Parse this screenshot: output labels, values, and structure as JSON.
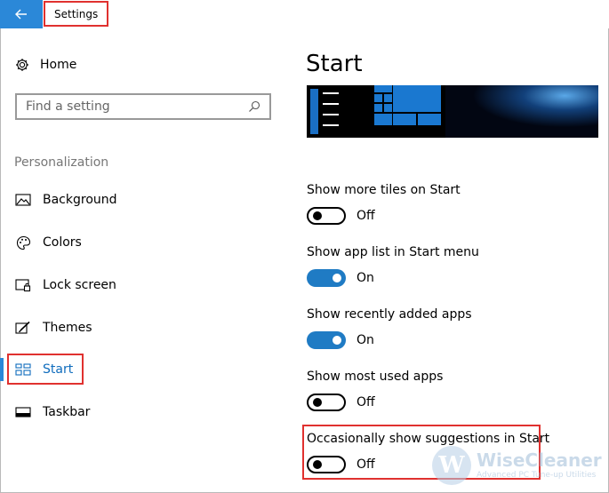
{
  "titlebar": {
    "title": "Settings"
  },
  "sidebar": {
    "home_label": "Home",
    "search_placeholder": "Find a setting",
    "section_title": "Personalization",
    "items": [
      {
        "label": "Background",
        "icon": "picture-icon"
      },
      {
        "label": "Colors",
        "icon": "palette-icon"
      },
      {
        "label": "Lock screen",
        "icon": "lock-screen-icon"
      },
      {
        "label": "Themes",
        "icon": "brush-icon"
      },
      {
        "label": "Start",
        "icon": "start-tiles-icon",
        "active": true
      },
      {
        "label": "Taskbar",
        "icon": "taskbar-icon"
      }
    ]
  },
  "main": {
    "title": "Start",
    "settings": [
      {
        "label": "Show more tiles on Start",
        "state": "Off",
        "on": false
      },
      {
        "label": "Show app list in Start menu",
        "state": "On",
        "on": true
      },
      {
        "label": "Show recently added apps",
        "state": "On",
        "on": true
      },
      {
        "label": "Show most used apps",
        "state": "Off",
        "on": false
      },
      {
        "label": "Occasionally show suggestions in Start",
        "state": "Off",
        "on": false
      }
    ]
  },
  "watermark": {
    "name": "WiseCleaner",
    "tagline": "Advanced PC Tune-up Utilities",
    "logo_letter": "W"
  },
  "colors": {
    "accent": "#2b88d8",
    "toggle_on": "#1f7bc4",
    "highlight": "#e0312f"
  }
}
